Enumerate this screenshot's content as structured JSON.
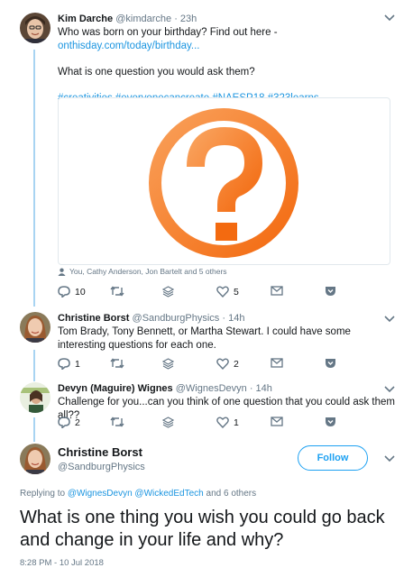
{
  "tweet1": {
    "name": "Kim Darche",
    "handle": "@kimdarche",
    "time": "· 23h",
    "line1_text": "Who was born on your birthday? Find out here - ",
    "line1_link": "onthisday.com/today/birthday...",
    "line2": "What is one question you would ask them?",
    "hashtags": "#creativities #everyonecancreate #NAESP18 #323learns",
    "media_icon": "question-mark-circle-icon",
    "media_color": "#f7761f",
    "social_context": "You, Cathy Anderson, Jon Bartelt and 5 others",
    "actions": {
      "replies": "10",
      "retweets": "",
      "likes": "5"
    }
  },
  "tweet2": {
    "name": "Christine Borst",
    "handle": "@SandburgPhysics",
    "time": "· 14h",
    "text": "Tom Brady, Tony Bennett, or Martha Stewart.   I could have some interesting questions for each one.",
    "actions": {
      "replies": "1",
      "retweets": "",
      "likes": "2"
    }
  },
  "tweet3": {
    "name": "Devyn (Maguire) Wignes",
    "handle": "@WignesDevyn",
    "time": "· 14h",
    "text": "Challenge for you...can you think of one question that you could ask them all??",
    "actions": {
      "replies": "2",
      "retweets": "",
      "likes": "1"
    }
  },
  "main_tweet": {
    "name": "Christine Borst",
    "handle": "@SandburgPhysics",
    "follow_label": "Follow",
    "replying_prefix": "Replying to ",
    "replying_users": "@WignesDevyn @WickedEdTech",
    "replying_suffix": " and 6 others",
    "text": "What is one thing you wish you could go back and change in your life and why?",
    "timestamp": "8:28 PM - 10 Jul 2018"
  },
  "colors": {
    "accent": "#1da1f2",
    "link": "#1b95e0",
    "thread": "#a8d4f2",
    "muted": "#657786"
  }
}
